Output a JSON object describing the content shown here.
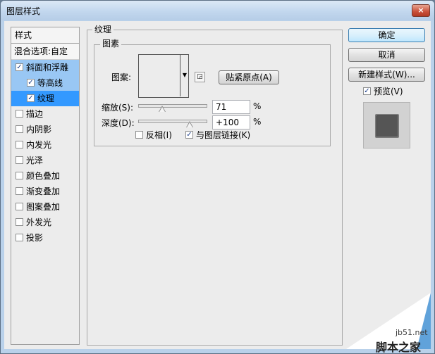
{
  "window": {
    "title": "图层样式",
    "close_icon": "×"
  },
  "left_panel": {
    "header": "样式",
    "blend_options": "混合选项:自定",
    "items": [
      {
        "label": "斜面和浮雕",
        "checked": true
      },
      {
        "label": "等高线",
        "checked": true
      },
      {
        "label": "纹理",
        "checked": true
      },
      {
        "label": "描边",
        "checked": false
      },
      {
        "label": "内阴影",
        "checked": false
      },
      {
        "label": "内发光",
        "checked": false
      },
      {
        "label": "光泽",
        "checked": false
      },
      {
        "label": "颜色叠加",
        "checked": false
      },
      {
        "label": "渐变叠加",
        "checked": false
      },
      {
        "label": "图案叠加",
        "checked": false
      },
      {
        "label": "外发光",
        "checked": false
      },
      {
        "label": "投影",
        "checked": false
      }
    ]
  },
  "texture_panel": {
    "group_title": "纹理",
    "sub_group_title": "图素",
    "pattern_label": "图案:",
    "snap_origin_button": "贴紧原点(A)",
    "scale_label": "缩放(S):",
    "scale_value": "71",
    "scale_unit": "%",
    "depth_label": "深度(D):",
    "depth_value": "+100",
    "depth_unit": "%",
    "invert_label": "反相(I)",
    "invert_checked": false,
    "link_label": "与图层链接(K)",
    "link_checked": true
  },
  "right_panel": {
    "ok_button": "确定",
    "cancel_button": "取消",
    "new_style_button": "新建样式(W)...",
    "preview_label": "预览(V)",
    "preview_checked": true
  },
  "watermark": {
    "site": "jb51.net",
    "text": "脚本之家"
  },
  "colors": {
    "selection": "#3399ff",
    "selection_light": "#99c7f4",
    "dialog_bg": "#ececec",
    "titlebar": "#c2d7ee"
  }
}
